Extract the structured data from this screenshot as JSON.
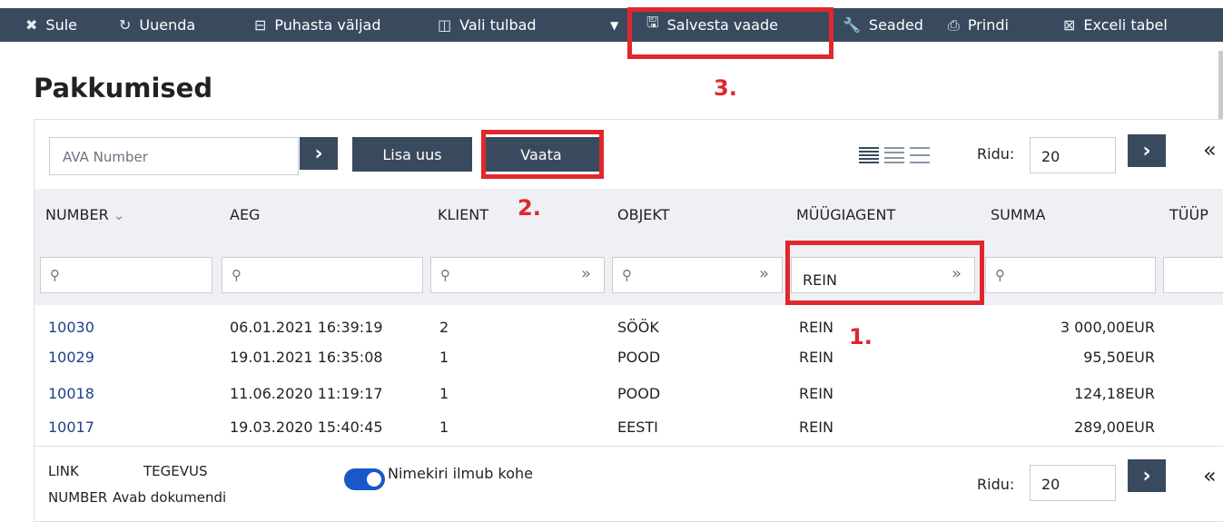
{
  "toolbar": {
    "items": [
      {
        "label": "Sule",
        "icon": "close-icon",
        "glyph": "✖"
      },
      {
        "label": "Uuenda",
        "icon": "refresh-icon",
        "glyph": "↻"
      },
      {
        "label": "Puhasta väljad",
        "icon": "clear-fields-icon",
        "glyph": "⊟"
      },
      {
        "label": "Vali tulbad",
        "icon": "columns-icon",
        "glyph": "◫"
      },
      {
        "label": "Salvesta vaade",
        "icon": "save-icon",
        "glyph": "🖫"
      },
      {
        "label": "Seaded",
        "icon": "wrench-icon",
        "glyph": "🔧"
      },
      {
        "label": "Prindi",
        "icon": "printer-icon",
        "glyph": "⎙"
      },
      {
        "label": "Exceli tabel",
        "icon": "excel-icon",
        "glyph": "⊠"
      }
    ],
    "dropdown_glyph": "▼"
  },
  "annotations": [
    "1.",
    "2.",
    "3."
  ],
  "page": {
    "title": "Pakkumised"
  },
  "controls": {
    "number_placeholder": "AVA Number",
    "go_glyph": "›",
    "add_new": "Lisa uus",
    "view": "Vaata",
    "rows_label": "Ridu:",
    "rows_value": "20",
    "first_glyph": "«"
  },
  "table": {
    "headers": [
      "NUMBER",
      "AEG",
      "KLIENT",
      "OBJEKT",
      "MÜÜGIAGENT",
      "SUMMA",
      "TÜÜP"
    ],
    "sort_glyph": "⌄",
    "filters": [
      {
        "value": "",
        "search_glyph": "⚲"
      },
      {
        "value": "",
        "search_glyph": "⚲"
      },
      {
        "value": "",
        "search_glyph": "⚲"
      },
      {
        "value": "",
        "search_glyph": "⚲"
      },
      {
        "value": "REIN",
        "search_glyph": ""
      },
      {
        "value": "",
        "search_glyph": "⚲"
      }
    ],
    "expand_glyph": "»",
    "rows": [
      {
        "number": "10030",
        "aeg": "06.01.2021 16:39:19",
        "klient": "2",
        "objekt": "SÖÖK",
        "agent": "REIN",
        "summa": "3 000,00EUR"
      },
      {
        "number": "10029",
        "aeg": "19.01.2021 16:35:08",
        "klient": "1",
        "objekt": "POOD",
        "agent": "REIN",
        "summa": "95,50EUR"
      },
      {
        "number": "10018",
        "aeg": "11.06.2020 11:19:17",
        "klient": "1",
        "objekt": "POOD",
        "agent": "REIN",
        "summa": "124,18EUR"
      },
      {
        "number": "10017",
        "aeg": "19.03.2020 15:40:45",
        "klient": "1",
        "objekt": "EESTI",
        "agent": "REIN",
        "summa": "289,00EUR"
      }
    ]
  },
  "footer": {
    "link": "LINK",
    "number": "NUMBER",
    "tegevus": "TEGEVUS",
    "avab": "Avab dokumendi",
    "toggle_label": "Nimekiri ilmub kohe",
    "rows_label": "Ridu:",
    "rows_value": "20"
  },
  "colors": {
    "toolbar_bg": "#3a4a5e",
    "annotation": "#e2262d",
    "link": "#1f3f8a",
    "toggle": "#1958c8"
  }
}
